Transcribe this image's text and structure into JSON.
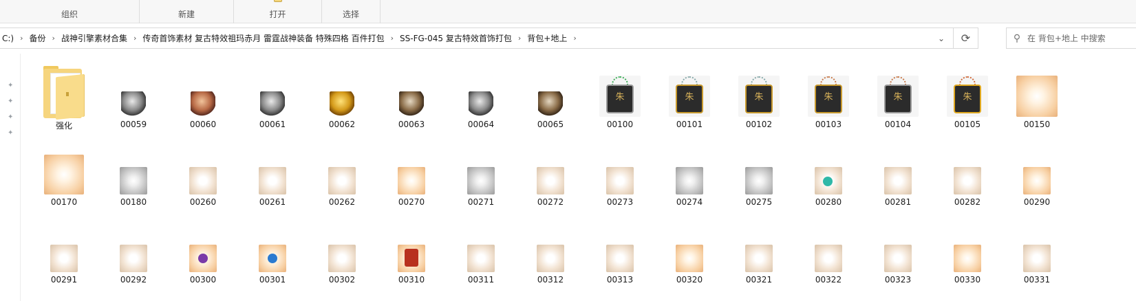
{
  "ribbon": {
    "groups": [
      "组织",
      "新建",
      "打开",
      "选择"
    ]
  },
  "address": {
    "crumbs": [
      "C:)",
      "备份",
      "战神引擎素材合集",
      "传奇首饰素材 复古特效祖玛赤月 雷霆战神装备 特殊四格 百件打包",
      "SS-FG-045 复古特效首饰打包",
      "背包+地上"
    ],
    "separator": "›",
    "dropdown_icon": "chevron-down-icon",
    "refresh_icon": "refresh-icon"
  },
  "search": {
    "placeholder": "在 背包+地上 中搜索",
    "icon": "search-icon"
  },
  "files": {
    "row1": [
      "强化",
      "00059",
      "00060",
      "00061",
      "00062",
      "00063",
      "00064",
      "00065",
      "00100",
      "00101",
      "00102",
      "00103",
      "00104",
      "00105",
      "00150"
    ],
    "row2": [
      "00170",
      "00180",
      "00260",
      "00261",
      "00262",
      "00270",
      "00271",
      "00272",
      "00273",
      "00274",
      "00275",
      "00280",
      "00281",
      "00282",
      "00290"
    ],
    "row3": [
      "00291",
      "00292",
      "00300",
      "00301",
      "00302",
      "00310",
      "00311",
      "00312",
      "00313",
      "00320",
      "00321",
      "00322",
      "00323",
      "00330",
      "00331"
    ]
  },
  "tag_glyph": "朱"
}
